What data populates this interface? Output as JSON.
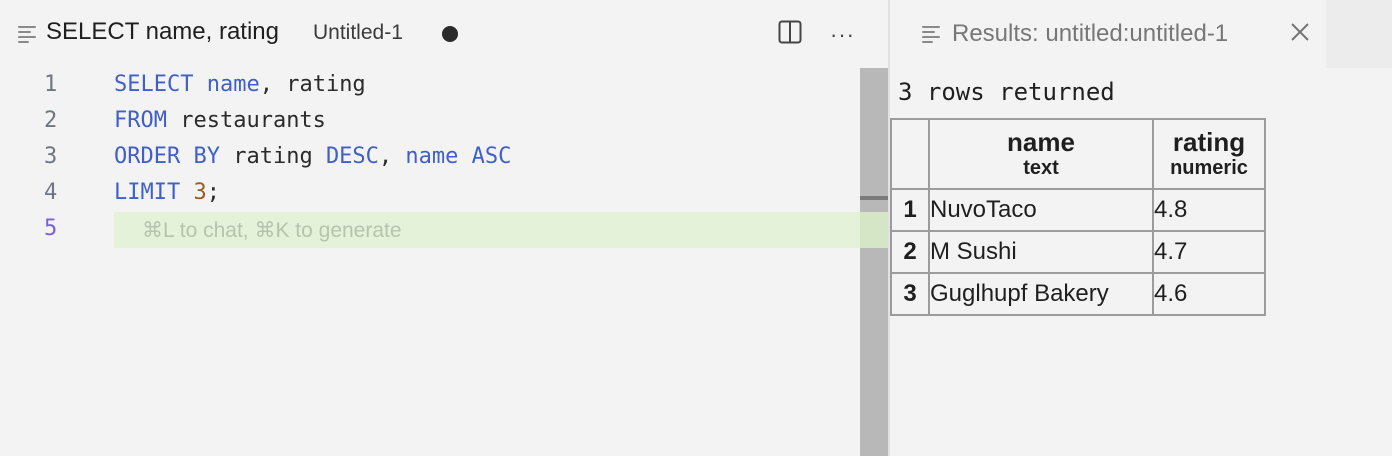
{
  "editor": {
    "tab_title": "SELECT name, rating",
    "tab_filename": "Untitled-1",
    "line_numbers": [
      "1",
      "2",
      "3",
      "4",
      "5"
    ],
    "code": {
      "l1_kw1": "SELECT",
      "l1_kw2": "name",
      "l1_rest": ", rating",
      "l2_kw": "FROM",
      "l2_rest": " restaurants",
      "l3_kw1": "ORDER BY",
      "l3_mid": " rating ",
      "l3_kw2": "DESC",
      "l3_comma": ", ",
      "l3_kw3": "name",
      "l3_sp": " ",
      "l3_kw4": "ASC",
      "l4_kw": "LIMIT",
      "l4_sp": " ",
      "l4_num": "3",
      "l4_end": ";"
    },
    "hint": "⌘L to chat, ⌘K to generate"
  },
  "results": {
    "tab_title": "Results: untitled:untitled-1",
    "rows_returned": "3 rows returned",
    "columns": [
      {
        "name": "name",
        "type": "text"
      },
      {
        "name": "rating",
        "type": "numeric"
      }
    ],
    "rows": [
      {
        "index": "1",
        "name": "NuvoTaco",
        "rating": "4.8"
      },
      {
        "index": "2",
        "name": "M Sushi",
        "rating": "4.7"
      },
      {
        "index": "3",
        "name": "Guglhupf Bakery",
        "rating": "4.6"
      }
    ]
  },
  "icons": {
    "tab_icon": "lines-icon",
    "split": "split-editor-icon",
    "more": "more-actions-icon",
    "dirty": "unsaved-dot-icon",
    "close": "close-icon"
  },
  "colors": {
    "keyword": "#3f5fc9",
    "number": "#9a5b27",
    "active_line_number": "#7b61d8",
    "current_line_highlight": "#e3f2d9"
  }
}
